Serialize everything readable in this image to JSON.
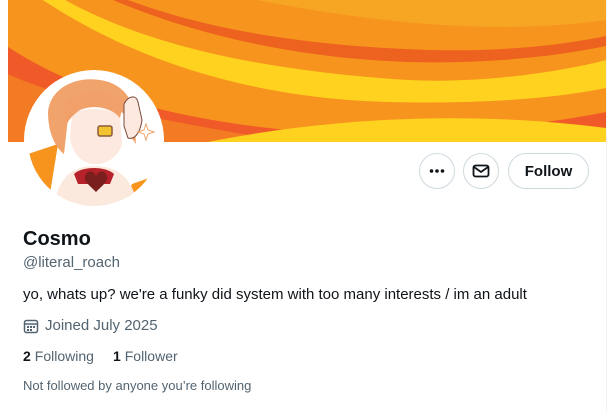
{
  "profile": {
    "display_name": "Cosmo",
    "handle": "@literal_roach",
    "bio": "yo, whats up? we're a funky did system with too many interests / im an adult",
    "joined": "Joined July 2025",
    "following_count": "2",
    "following_label": "Following",
    "followers_count": "1",
    "followers_label": "Follower",
    "mutuals_note": "Not followed by anyone you’re following"
  },
  "actions": {
    "more_icon": "more-horizontal-icon",
    "message_icon": "envelope-icon",
    "follow_label": "Follow"
  },
  "icons": {
    "joined": "calendar-icon"
  },
  "colors": {
    "banner_orange": "#f7941d",
    "banner_red": "#f05a28",
    "banner_yellow": "#ffd21f",
    "text_primary": "#0f1419",
    "text_secondary": "#536471",
    "border": "#cfd9de"
  }
}
